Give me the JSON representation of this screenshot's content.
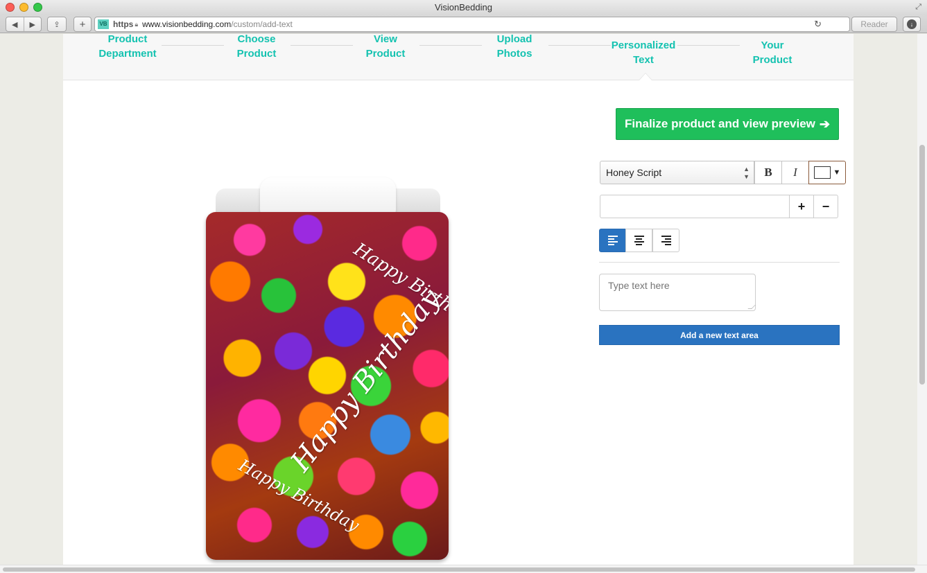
{
  "window": {
    "title": "VisionBedding"
  },
  "toolbar": {
    "favicon_text": "VB",
    "https_label": "https",
    "url_host": "www.visionbedding.com",
    "url_path": "/custom/add-text",
    "reader_label": "Reader",
    "back_glyph": "◀",
    "forward_glyph": "▶",
    "share_glyph": "⇪",
    "new_tab_glyph": "+",
    "reload_glyph": "↻",
    "download_glyph": "↓"
  },
  "steps": [
    {
      "label_line1": "Product",
      "label_line2": "Department"
    },
    {
      "label_line1": "Choose",
      "label_line2": "Product"
    },
    {
      "label_line1": "View",
      "label_line2": "Product"
    },
    {
      "label_line1": "Upload",
      "label_line2": "Photos"
    },
    {
      "label_line1": "Personalized",
      "label_line2": "Text",
      "active": true
    },
    {
      "label_line1": "Your",
      "label_line2": "Product"
    }
  ],
  "product": {
    "overlay_texts": [
      "Happy Birthday",
      "Happy Birthday",
      "Happy Birthday"
    ]
  },
  "editor": {
    "finalize_label": "Finalize product and view preview",
    "finalize_icon": "➔",
    "font_selected": "Honey Script",
    "bold_label": "B",
    "italic_label": "I",
    "color_dropdown_glyph": "▼",
    "text_color": "#ffffff",
    "size_value": "",
    "plus_label": "+",
    "minus_label": "−",
    "alignment": "left",
    "text_placeholder": "Type text here",
    "add_text_label": "Add a new text area"
  },
  "colors": {
    "step_accent": "#14c2b0",
    "finalize_green": "#1fbf5b",
    "primary_blue": "#2a73c0"
  }
}
